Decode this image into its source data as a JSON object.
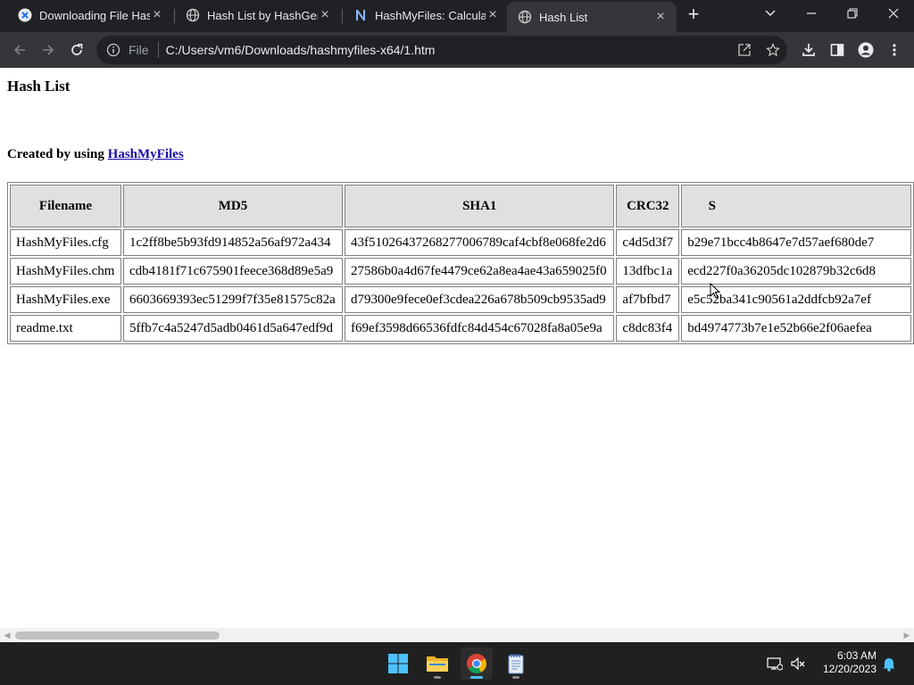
{
  "browser": {
    "tabs": [
      {
        "title": "Downloading File Hash",
        "icon": "hash-app-icon"
      },
      {
        "title": "Hash List by HashGene",
        "icon": "globe-icon"
      },
      {
        "title": "HashMyFiles: Calculate",
        "icon": "notion-n-icon"
      },
      {
        "title": "Hash List",
        "icon": "globe-icon"
      }
    ],
    "address": {
      "scheme": "File",
      "url": "C:/Users/vm6/Downloads/hashmyfiles-x64/1.htm"
    }
  },
  "page": {
    "heading": "Hash List",
    "created_prefix": "Created by using ",
    "created_link": "HashMyFiles",
    "table": {
      "columns": [
        "Filename",
        "MD5",
        "SHA1",
        "CRC32",
        "S"
      ],
      "rows": [
        [
          "HashMyFiles.cfg",
          "1c2ff8be5b93fd914852a56af972a434",
          "43f5102643726827700678 9caf4cbf8e068fe2d6",
          "c4d5d3f7",
          "b29e71bcc4b8647e7d57aef680de7"
        ],
        [
          "HashMyFiles.chm",
          "cdb4181f71c675901feece368d89e5a9",
          "27586b0a4d67fe4479ce62a8ea4ae43a659025f0",
          "13dfbc1a",
          "ecd227f0a36205dc102879b32c6d8"
        ],
        [
          "HashMyFiles.exe",
          "6603669393ec51299f7f35e81575c82a",
          "d79300e9fece0ef3cdea226a678b509cb9535ad9",
          "af7bfbd7",
          "e5c52ba341c90561a2ddfcb92a7ef"
        ],
        [
          "readme.txt",
          "5ffb7c4a5247d5adb0461d5a647edf9d",
          "f69ef3598d66536fdfc84d454c67028fa8a05e9a",
          "c8dc83f4",
          "bd4974773b7e1e52b66e2f06aefea"
        ]
      ]
    }
  },
  "taskbar": {
    "clock_time": "6:03 AM",
    "clock_date": "12/20/2023"
  },
  "colors": {
    "tab_strip": "#202124",
    "toolbar": "#35363a",
    "link": "#1a0dab",
    "header_cell": "#e0e0e0",
    "taskbar": "#202020",
    "accent": "#4cc2ff"
  }
}
